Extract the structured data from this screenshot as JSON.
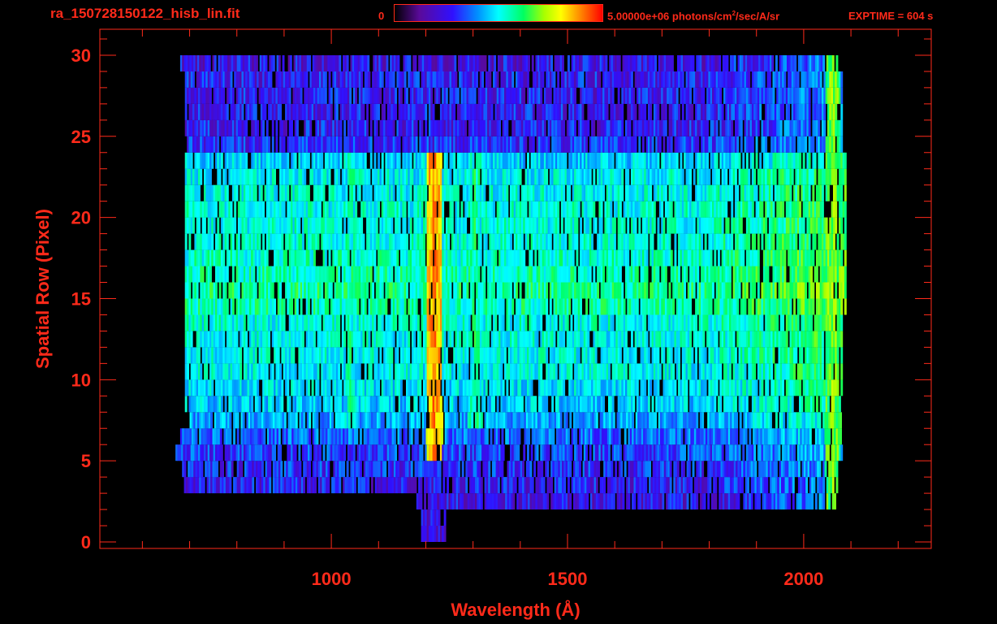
{
  "header": {
    "filename": "ra_150728150122_hisb_lin.fit",
    "colorbar_min": "0",
    "colorbar_max_prefix": "5.00000e+06 photons/cm",
    "colorbar_max_exp": "2",
    "colorbar_max_suffix": "/sec/A/sr",
    "exptime": "EXPTIME = 604 s"
  },
  "chart_data": {
    "type": "heatmap",
    "xlabel": "Wavelength (Å)",
    "ylabel": "Spatial Row (Pixel)",
    "xlim": [
      510,
      2270
    ],
    "ylim": [
      -0.4,
      31.6
    ],
    "x_ticks": [
      1000,
      1500,
      2000
    ],
    "y_ticks": [
      0,
      5,
      10,
      15,
      20,
      25,
      30
    ],
    "colorbar": {
      "min": 0,
      "max": 5000000,
      "units": "photons/cm^2/sec/A/sr"
    },
    "colormap": [
      "#000000",
      "#5a0a9a",
      "#3010ff",
      "#0090ff",
      "#00ffff",
      "#00ff60",
      "#a8ff00",
      "#ffff00",
      "#ff8000",
      "#ff0000"
    ],
    "rows": [
      {
        "row": 0,
        "x_start": 1190,
        "x_end": 1240,
        "level": 0.18
      },
      {
        "row": 1,
        "x_start": 1190,
        "x_end": 1240,
        "level": 0.18
      },
      {
        "row": 2,
        "x_start": 1180,
        "x_end": 2070,
        "level": 0.2
      },
      {
        "row": 3,
        "x_start": 680,
        "x_end": 2070,
        "level": 0.22
      },
      {
        "row": 4,
        "x_start": 680,
        "x_end": 2070,
        "level": 0.24
      },
      {
        "row": 5,
        "x_start": 670,
        "x_end": 2080,
        "level": 0.26
      },
      {
        "row": 6,
        "x_start": 680,
        "x_end": 2080,
        "level": 0.3
      },
      {
        "row": 7,
        "x_start": 700,
        "x_end": 2080,
        "level": 0.36
      },
      {
        "row": 8,
        "x_start": 690,
        "x_end": 2080,
        "level": 0.4
      },
      {
        "row": 9,
        "x_start": 690,
        "x_end": 2080,
        "level": 0.42
      },
      {
        "row": 10,
        "x_start": 690,
        "x_end": 2080,
        "level": 0.44
      },
      {
        "row": 11,
        "x_start": 690,
        "x_end": 2080,
        "level": 0.45
      },
      {
        "row": 12,
        "x_start": 690,
        "x_end": 2080,
        "level": 0.45
      },
      {
        "row": 13,
        "x_start": 690,
        "x_end": 2080,
        "level": 0.46
      },
      {
        "row": 14,
        "x_start": 690,
        "x_end": 2090,
        "level": 0.5
      },
      {
        "row": 15,
        "x_start": 690,
        "x_end": 2090,
        "level": 0.52
      },
      {
        "row": 16,
        "x_start": 690,
        "x_end": 2090,
        "level": 0.5
      },
      {
        "row": 17,
        "x_start": 690,
        "x_end": 2090,
        "level": 0.48
      },
      {
        "row": 18,
        "x_start": 690,
        "x_end": 2090,
        "level": 0.47
      },
      {
        "row": 19,
        "x_start": 690,
        "x_end": 2090,
        "level": 0.46
      },
      {
        "row": 20,
        "x_start": 690,
        "x_end": 2090,
        "level": 0.46
      },
      {
        "row": 21,
        "x_start": 690,
        "x_end": 2090,
        "level": 0.45
      },
      {
        "row": 22,
        "x_start": 690,
        "x_end": 2090,
        "level": 0.44
      },
      {
        "row": 23,
        "x_start": 690,
        "x_end": 2090,
        "level": 0.4
      },
      {
        "row": 24,
        "x_start": 690,
        "x_end": 2080,
        "level": 0.24
      },
      {
        "row": 25,
        "x_start": 690,
        "x_end": 2080,
        "level": 0.22
      },
      {
        "row": 26,
        "x_start": 690,
        "x_end": 2080,
        "level": 0.22
      },
      {
        "row": 27,
        "x_start": 690,
        "x_end": 2080,
        "level": 0.22
      },
      {
        "row": 28,
        "x_start": 690,
        "x_end": 2080,
        "level": 0.22
      },
      {
        "row": 29,
        "x_start": 680,
        "x_end": 2070,
        "level": 0.2
      }
    ],
    "emission_lines": [
      {
        "wavelength": 1216,
        "level": 0.88,
        "row_start": 5,
        "row_end": 24
      },
      {
        "wavelength": 1040,
        "level": 0.5,
        "row_start": 7,
        "row_end": 24
      },
      {
        "wavelength": 1304,
        "level": 0.52,
        "row_start": 7,
        "row_end": 24
      },
      {
        "wavelength": 2060,
        "level": 0.65,
        "row_start": 2,
        "row_end": 30
      }
    ]
  }
}
